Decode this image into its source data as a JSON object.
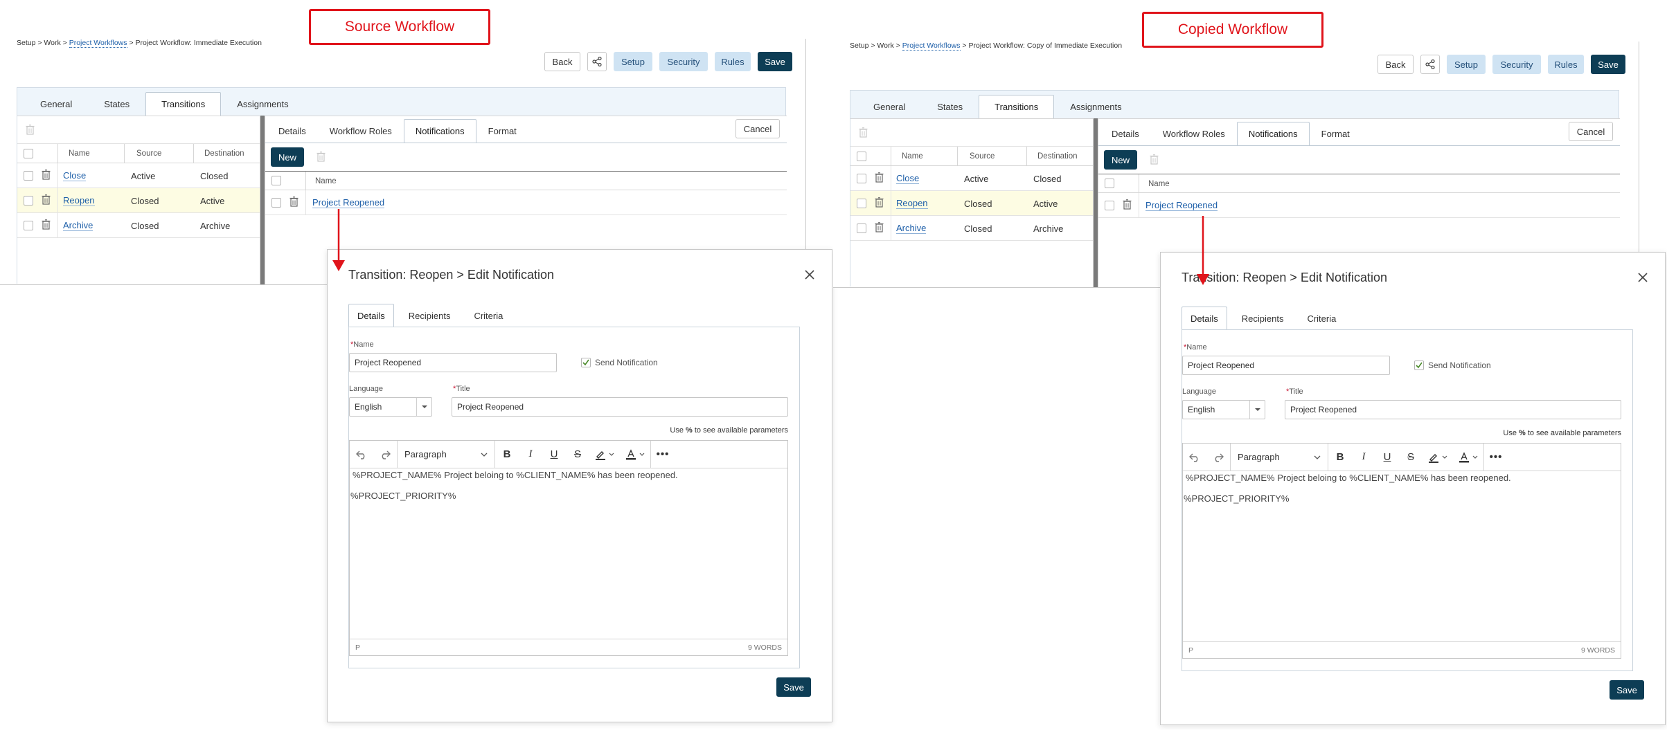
{
  "panels": [
    {
      "callout": "Source Workflow",
      "breadcrumb": {
        "prefix": "Setup > Work > ",
        "link": "Project Workflows",
        "suffix": " > Project Workflow: Immediate Execution"
      },
      "toolbar": {
        "back": "Back",
        "setup": "Setup",
        "security": "Security",
        "rules": "Rules",
        "save": "Save"
      },
      "main_tabs": [
        "General",
        "States",
        "Transitions",
        "Assignments"
      ],
      "transitions": {
        "headers": [
          "Name",
          "Source",
          "Destination"
        ],
        "rows": [
          {
            "name": "Close",
            "source": "Active",
            "destination": "Closed"
          },
          {
            "name": "Reopen",
            "source": "Closed",
            "destination": "Active"
          },
          {
            "name": "Archive",
            "source": "Closed",
            "destination": "Archive"
          }
        ]
      },
      "detail_tabs": [
        "Details",
        "Workflow Roles",
        "Notifications",
        "Format"
      ],
      "cancel": "Cancel",
      "new_button": "New",
      "notifications": {
        "header": "Name",
        "rows": [
          "Project Reopened"
        ]
      },
      "modal": {
        "title": "Transition: Reopen > Edit Notification",
        "tabs": [
          "Details",
          "Recipients",
          "Criteria"
        ],
        "name_label": "Name",
        "name_value": "Project Reopened",
        "send_notification": "Send Notification",
        "language_label": "Language",
        "language_value": "English",
        "title_label": "Title",
        "title_value": "Project Reopened",
        "hint_prefix": "Use ",
        "hint_symbol": "%",
        "hint_suffix": " to see available parameters",
        "paragraph": "Paragraph",
        "body_line1": "%PROJECT_NAME% Project  beloing to %CLIENT_NAME% has been reopened.",
        "body_line2": "%PROJECT_PRIORITY%",
        "status_left": "P",
        "status_right": "9 WORDS",
        "save": "Save"
      }
    },
    {
      "callout": "Copied Workflow",
      "breadcrumb": {
        "prefix": "Setup > Work > ",
        "link": "Project Workflows",
        "suffix": " > Project Workflow: Copy of Immediate Execution"
      },
      "toolbar": {
        "back": "Back",
        "setup": "Setup",
        "security": "Security",
        "rules": "Rules",
        "save": "Save"
      },
      "main_tabs": [
        "General",
        "States",
        "Transitions",
        "Assignments"
      ],
      "transitions": {
        "headers": [
          "Name",
          "Source",
          "Destination"
        ],
        "rows": [
          {
            "name": "Close",
            "source": "Active",
            "destination": "Closed"
          },
          {
            "name": "Reopen",
            "source": "Closed",
            "destination": "Active"
          },
          {
            "name": "Archive",
            "source": "Closed",
            "destination": "Archive"
          }
        ]
      },
      "detail_tabs": [
        "Details",
        "Workflow Roles",
        "Notifications",
        "Format"
      ],
      "cancel": "Cancel",
      "new_button": "New",
      "notifications": {
        "header": "Name",
        "rows": [
          "Project Reopened"
        ]
      },
      "modal": {
        "title": "Transition: Reopen > Edit Notification",
        "tabs": [
          "Details",
          "Recipients",
          "Criteria"
        ],
        "name_label": "Name",
        "name_value": "Project Reopened",
        "send_notification": "Send Notification",
        "language_label": "Language",
        "language_value": "English",
        "title_label": "Title",
        "title_value": "Project Reopened",
        "hint_prefix": "Use ",
        "hint_symbol": "%",
        "hint_suffix": " to see available parameters",
        "paragraph": "Paragraph",
        "body_line1": "%PROJECT_NAME% Project  beloing to %CLIENT_NAME% has been reopened.",
        "body_line2": "%PROJECT_PRIORITY%",
        "status_left": "P",
        "status_right": "9 WORDS",
        "save": "Save"
      }
    }
  ],
  "colors": {
    "callout": "#e0141b",
    "primary": "#0d3d55",
    "light_button": "#cfe3f3",
    "link": "#1c5ea8",
    "highlight_row": "#fdfce3"
  },
  "icons": [
    "share-icon",
    "trash-icon",
    "checkbox-icon",
    "close-icon",
    "undo-icon",
    "redo-icon",
    "bold-icon",
    "italic-icon",
    "underline-icon",
    "strikethrough-icon",
    "highlight-icon",
    "font-color-icon",
    "more-icon",
    "chevron-down-icon",
    "check-icon"
  ]
}
